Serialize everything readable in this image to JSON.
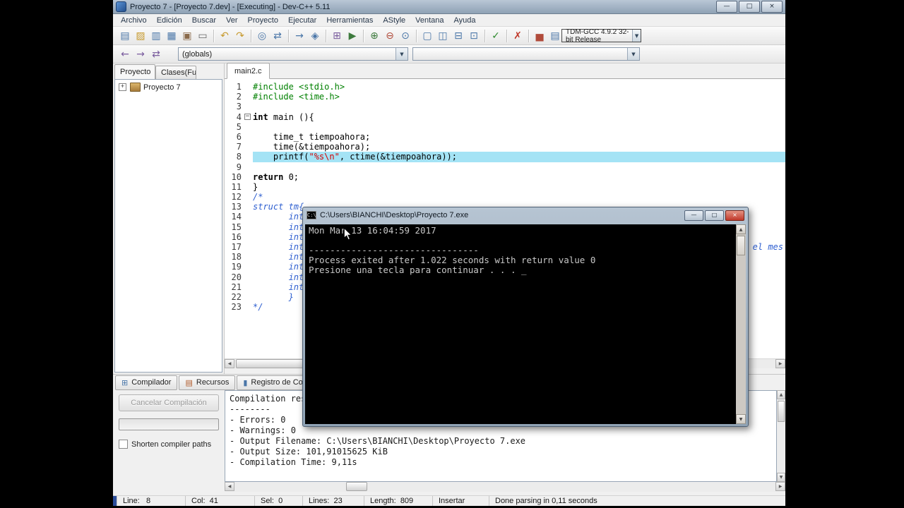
{
  "window": {
    "title": "Proyecto 7 - [Proyecto 7.dev] - [Executing] - Dev-C++ 5.11"
  },
  "menu": {
    "items": [
      "Archivo",
      "Edición",
      "Buscar",
      "Ver",
      "Proyecto",
      "Ejecutar",
      "Herramientas",
      "AStyle",
      "Ventana",
      "Ayuda"
    ]
  },
  "toolbars": {
    "compiler_profile": "TDM-GCC 4.9.2 32-bit Release",
    "globals": "(globals)",
    "row1_icons": [
      {
        "name": "new-file-icon",
        "glyph": "▤",
        "color": "#4a76a8"
      },
      {
        "name": "open-file-icon",
        "glyph": "▨",
        "color": "#c79a2e"
      },
      {
        "name": "save-icon",
        "glyph": "▥",
        "color": "#4a76a8"
      },
      {
        "name": "save-all-icon",
        "glyph": "▦",
        "color": "#4a76a8"
      },
      {
        "name": "close-file-icon",
        "glyph": "▣",
        "color": "#8a6a4a"
      },
      {
        "name": "print-icon",
        "glyph": "▭",
        "color": "#666666"
      },
      {
        "name": "sep"
      },
      {
        "name": "undo-icon",
        "glyph": "↶",
        "color": "#c79a2e"
      },
      {
        "name": "redo-icon",
        "glyph": "↷",
        "color": "#c79a2e"
      },
      {
        "name": "sep"
      },
      {
        "name": "find-icon",
        "glyph": "◎",
        "color": "#4a76a8"
      },
      {
        "name": "replace-icon",
        "glyph": "⇄",
        "color": "#4a76a8"
      },
      {
        "name": "sep"
      },
      {
        "name": "goto-line-icon",
        "glyph": "→",
        "color": "#4a76a8"
      },
      {
        "name": "bookmark-icon",
        "glyph": "◈",
        "color": "#4a76a8"
      },
      {
        "name": "sep"
      },
      {
        "name": "compile-icon",
        "glyph": "⊞",
        "color": "#7a5c9e"
      },
      {
        "name": "run-icon",
        "glyph": "▶",
        "color": "#3d7a3d"
      },
      {
        "name": "sep"
      },
      {
        "name": "add-to-project-icon",
        "glyph": "⊕",
        "color": "#3d7a3d"
      },
      {
        "name": "remove-from-project-icon",
        "glyph": "⊖",
        "color": "#b04a3a"
      },
      {
        "name": "project-options-icon",
        "glyph": "⊙",
        "color": "#4a76a8"
      },
      {
        "name": "sep"
      },
      {
        "name": "cascade-windows-icon",
        "glyph": "▢",
        "color": "#4a76a8"
      },
      {
        "name": "tile-horizontal-icon",
        "glyph": "◫",
        "color": "#4a76a8"
      },
      {
        "name": "tile-vertical-icon",
        "glyph": "⊟",
        "color": "#4a76a8"
      },
      {
        "name": "fullscreen-icon",
        "glyph": "⊡",
        "color": "#4a76a8"
      },
      {
        "name": "sep"
      },
      {
        "name": "syntax-check-icon",
        "glyph": "✓",
        "color": "#2e8b2e"
      },
      {
        "name": "sep"
      },
      {
        "name": "abort-compile-icon",
        "glyph": "✗",
        "color": "#c0392b"
      },
      {
        "name": "sep"
      },
      {
        "name": "profile-icon",
        "glyph": "▅",
        "color": "#b04a3a"
      },
      {
        "name": "profiling-log-icon",
        "glyph": "▤",
        "color": "#4a76a8"
      }
    ],
    "row2_icons": [
      {
        "name": "goto-back-icon",
        "glyph": "←",
        "color": "#7a5c9e"
      },
      {
        "name": "goto-forward-icon",
        "glyph": "→",
        "color": "#7a5c9e"
      },
      {
        "name": "swap-header-source-icon",
        "glyph": "⇄",
        "color": "#7a5c9e"
      }
    ]
  },
  "sidebar": {
    "tabs": [
      {
        "label": "Proyecto",
        "active": true
      },
      {
        "label": "Clases(Fun",
        "active": false
      }
    ],
    "project": "Proyecto 7"
  },
  "editor": {
    "tab": "main2.c",
    "active_line": 8,
    "lines": [
      {
        "n": 1,
        "seg": [
          {
            "t": "#include <stdio.h>",
            "c": "pp"
          }
        ]
      },
      {
        "n": 2,
        "seg": [
          {
            "t": "#include <time.h>",
            "c": "pp"
          }
        ]
      },
      {
        "n": 3,
        "seg": []
      },
      {
        "n": 4,
        "fold": true,
        "seg": [
          {
            "t": "int",
            "c": "kw"
          },
          {
            "t": " main (){",
            "c": "pl"
          }
        ]
      },
      {
        "n": 5,
        "seg": []
      },
      {
        "n": 6,
        "seg": [
          {
            "t": "    time_t tiempoahora;",
            "c": "pl"
          }
        ]
      },
      {
        "n": 7,
        "seg": [
          {
            "t": "    time(&tiempoahora);",
            "c": "pl"
          }
        ]
      },
      {
        "n": 8,
        "seg": [
          {
            "t": "    printf(",
            "c": "pl"
          },
          {
            "t": "\"%s\\n\"",
            "c": "str"
          },
          {
            "t": ", ctime(&tiempoahora));",
            "c": "pl"
          }
        ]
      },
      {
        "n": 9,
        "seg": []
      },
      {
        "n": 10,
        "seg": [
          {
            "t": "return",
            "c": "kw"
          },
          {
            "t": " 0;",
            "c": "pl"
          }
        ]
      },
      {
        "n": 11,
        "seg": [
          {
            "t": "}",
            "c": "pl"
          }
        ]
      },
      {
        "n": 12,
        "seg": [
          {
            "t": "/*",
            "c": "cm"
          }
        ]
      },
      {
        "n": 13,
        "seg": [
          {
            "t": "struct tm{",
            "c": "cm"
          }
        ]
      },
      {
        "n": 14,
        "seg": [
          {
            "t": "       int",
            "c": "cm"
          }
        ]
      },
      {
        "n": 15,
        "seg": [
          {
            "t": "       int",
            "c": "cm"
          }
        ]
      },
      {
        "n": 16,
        "seg": [
          {
            "t": "       int",
            "c": "cm"
          }
        ]
      },
      {
        "n": 17,
        "frag": "ro el mes",
        "seg": [
          {
            "t": "       int",
            "c": "cm"
          }
        ]
      },
      {
        "n": 18,
        "seg": [
          {
            "t": "       int",
            "c": "cm"
          }
        ]
      },
      {
        "n": 19,
        "seg": [
          {
            "t": "       int",
            "c": "cm"
          }
        ]
      },
      {
        "n": 20,
        "seg": [
          {
            "t": "       int",
            "c": "cm"
          }
        ]
      },
      {
        "n": 21,
        "seg": [
          {
            "t": "       int",
            "c": "cm"
          }
        ]
      },
      {
        "n": 22,
        "seg": [
          {
            "t": "       }",
            "c": "cm"
          }
        ]
      },
      {
        "n": 23,
        "seg": [
          {
            "t": "*/",
            "c": "cm"
          }
        ]
      }
    ]
  },
  "console": {
    "title": "C:\\Users\\BIANCHI\\Desktop\\Proyecto 7.exe",
    "lines": [
      "Mon Mar 13 16:04:59 2017",
      "",
      "--------------------------------",
      "Process exited after 1.022 seconds with return value 0",
      "Presione una tecla para continuar . . . _"
    ]
  },
  "bottom": {
    "tabs": [
      {
        "label": "Compilador",
        "icon": "compiler-tab-icon",
        "glyph": "⊞",
        "color": "#4a76a8"
      },
      {
        "label": "Recursos",
        "icon": "resources-tab-icon",
        "glyph": "▤",
        "color": "#b05a2a"
      },
      {
        "label": "Registro de Co",
        "icon": "compile-log-tab-icon",
        "glyph": "▮",
        "color": "#4a76a8"
      }
    ],
    "cancel_button": "Cancelar Compilación",
    "shorten_label": "Shorten compiler paths",
    "log": [
      "Compilation res",
      "--------",
      "- Errors: 0",
      "- Warnings: 0",
      "- Output Filename: C:\\Users\\BIANCHI\\Desktop\\Proyecto 7.exe",
      "- Output Size: 101,91015625 KiB",
      "- Compilation Time: 9,11s"
    ]
  },
  "statusbar": {
    "segments": [
      "Line:   8",
      "Col:  41",
      "Sel:  0",
      "Lines:  23",
      "Length:  809",
      "Insertar",
      "Done parsing in 0,11 seconds"
    ]
  },
  "glyphs": {
    "minimize": "—",
    "maximize": "□",
    "close": "×",
    "up": "▲",
    "down": "▼",
    "left": "◀",
    "right": "▶",
    "tab_prev": "◂",
    "tab_next": "▸",
    "combo_arrow": "▼",
    "expander": "+",
    "fold": "−",
    "console_icon_label": "C:\\"
  }
}
